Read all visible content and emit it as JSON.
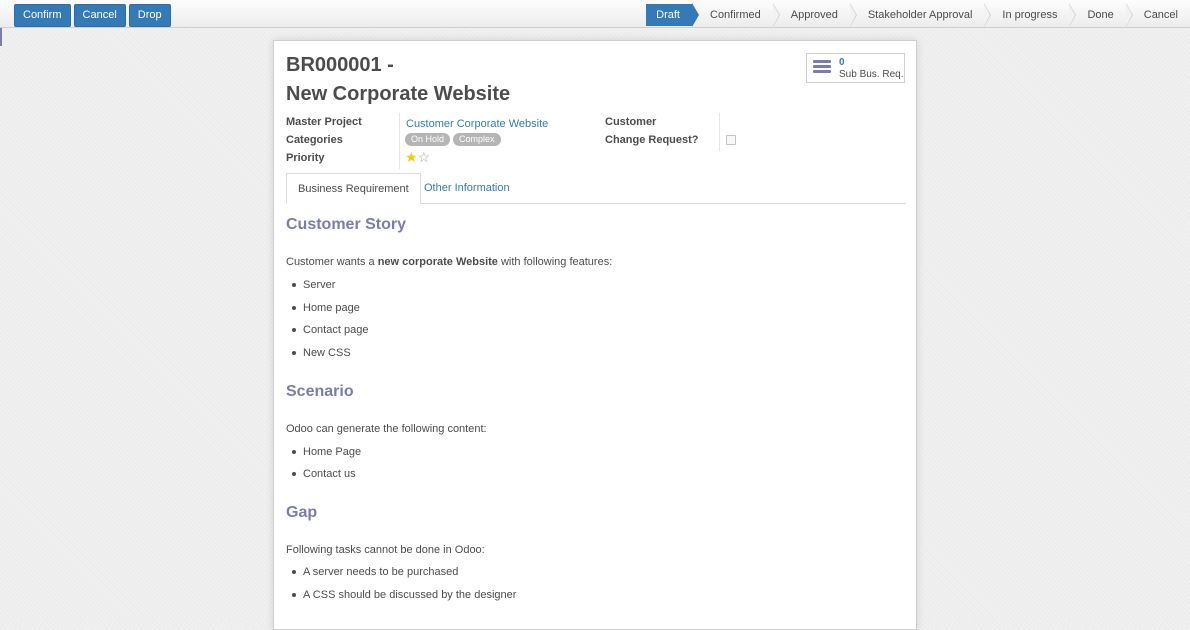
{
  "actions": {
    "confirm": "Confirm",
    "cancel": "Cancel",
    "drop": "Drop"
  },
  "stages": [
    "Draft",
    "Confirmed",
    "Approved",
    "Stakeholder Approval",
    "In progress",
    "Done",
    "Cancel"
  ],
  "active_stage": "Draft",
  "record": {
    "reference": "BR000001 -",
    "name": "New Corporate Website"
  },
  "smart_button": {
    "count": "0",
    "label": "Sub Bus. Req."
  },
  "fields": {
    "master_project_label": "Master Project",
    "master_project_value": "Customer Corporate Website",
    "categories_label": "Categories",
    "categories": [
      "On Hold",
      "Complex"
    ],
    "priority_label": "Priority",
    "priority_stars": {
      "filled": 1,
      "total": 2
    },
    "customer_label": "Customer",
    "customer_value": "",
    "change_request_label": "Change Request?",
    "change_request_checked": false
  },
  "tabs": {
    "business_requirement": "Business Requirement",
    "other_information": "Other Information"
  },
  "content": {
    "customer_story_heading": "Customer Story",
    "customer_story_intro_pre": "Customer wants a ",
    "customer_story_intro_bold": "new corporate Website",
    "customer_story_intro_post": " with following features:",
    "customer_story_items": [
      "Server",
      "Home page",
      "Contact page",
      "New CSS"
    ],
    "scenario_heading": "Scenario",
    "scenario_intro": "Odoo can generate the following content:",
    "scenario_items": [
      "Home Page",
      "Contact us"
    ],
    "gap_heading": "Gap",
    "gap_intro": "Following tasks cannot be done in Odoo:",
    "gap_items": [
      "A server needs to be purchased",
      "A CSS should be discussed by the designer"
    ]
  }
}
